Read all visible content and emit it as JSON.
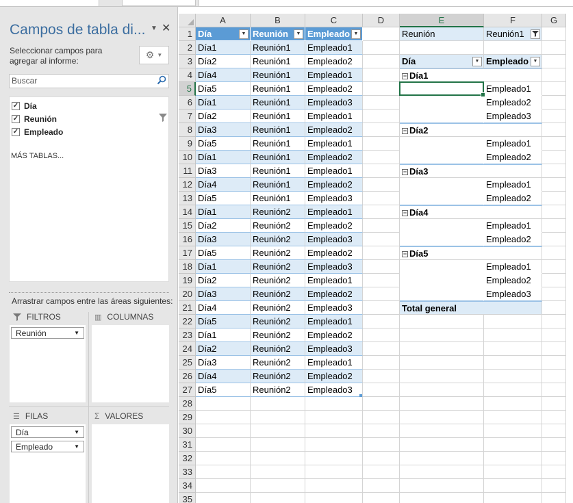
{
  "pane": {
    "title": "Campos de tabla di...",
    "subtitle": "Seleccionar campos para agregar al informe:",
    "search_placeholder": "Buscar",
    "fields": [
      {
        "label": "Día",
        "checked": true
      },
      {
        "label": "Reunión",
        "checked": true,
        "filtered": true
      },
      {
        "label": "Empleado",
        "checked": true
      }
    ],
    "more_tables": "MÁS TABLAS...",
    "drag_label": "Arrastrar campos entre las áreas siguientes:",
    "areas": {
      "filters": {
        "label": "FILTROS",
        "chips": [
          "Reunión"
        ]
      },
      "columns": {
        "label": "COLUMNAS",
        "chips": []
      },
      "rows": {
        "label": "FILAS",
        "chips": [
          "Día",
          "Empleado"
        ]
      },
      "values": {
        "label": "VALORES",
        "chips": []
      }
    }
  },
  "grid": {
    "columns": [
      "A",
      "B",
      "C",
      "D",
      "E",
      "F",
      "G"
    ],
    "selected_column": "E",
    "selected_row": 5,
    "rows": [
      1,
      2,
      3,
      4,
      5,
      6,
      7,
      8,
      9,
      10,
      11,
      12,
      13,
      14,
      15,
      16,
      17,
      18,
      19,
      20,
      21,
      22,
      23,
      24,
      25,
      26,
      27,
      28,
      29,
      30,
      31,
      32,
      33,
      34,
      35
    ],
    "table_headers": [
      "Día",
      "Reunión",
      "Empleado"
    ],
    "table_rows": [
      [
        "Día1",
        "Reunión1",
        "Empleado1"
      ],
      [
        "Día2",
        "Reunión1",
        "Empleado2"
      ],
      [
        "Día4",
        "Reunión1",
        "Empleado1"
      ],
      [
        "Día5",
        "Reunión1",
        "Empleado2"
      ],
      [
        "Día1",
        "Reunión1",
        "Empleado3"
      ],
      [
        "Día2",
        "Reunión1",
        "Empleado1"
      ],
      [
        "Día3",
        "Reunión1",
        "Empleado2"
      ],
      [
        "Día5",
        "Reunión1",
        "Empleado1"
      ],
      [
        "Día1",
        "Reunión1",
        "Empleado2"
      ],
      [
        "Día3",
        "Reunión1",
        "Empleado1"
      ],
      [
        "Día4",
        "Reunión1",
        "Empleado2"
      ],
      [
        "Día5",
        "Reunión1",
        "Empleado3"
      ],
      [
        "Día1",
        "Reunión2",
        "Empleado1"
      ],
      [
        "Día2",
        "Reunión2",
        "Empleado2"
      ],
      [
        "Día3",
        "Reunión2",
        "Empleado3"
      ],
      [
        "Día5",
        "Reunión2",
        "Empleado2"
      ],
      [
        "Día1",
        "Reunión2",
        "Empleado3"
      ],
      [
        "Día2",
        "Reunión2",
        "Empleado1"
      ],
      [
        "Día3",
        "Reunión2",
        "Empleado2"
      ],
      [
        "Día4",
        "Reunión2",
        "Empleado3"
      ],
      [
        "Día5",
        "Reunión2",
        "Empleado1"
      ],
      [
        "Día1",
        "Reunión2",
        "Empleado2"
      ],
      [
        "Día2",
        "Reunión2",
        "Empleado3"
      ],
      [
        "Día3",
        "Reunión2",
        "Empleado1"
      ],
      [
        "Día4",
        "Reunión2",
        "Empleado2"
      ],
      [
        "Día5",
        "Reunión2",
        "Empleado3"
      ]
    ],
    "pivot": {
      "filter_label": "Reunión",
      "filter_value": "Reunión1",
      "row_header": "Día",
      "col_header": "Empleado",
      "groups": [
        {
          "day": "Día1",
          "employees": [
            "Empleado1",
            "Empleado2",
            "Empleado3"
          ]
        },
        {
          "day": "Día2",
          "employees": [
            "Empleado1",
            "Empleado2"
          ]
        },
        {
          "day": "Día3",
          "employees": [
            "Empleado1",
            "Empleado2"
          ]
        },
        {
          "day": "Día4",
          "employees": [
            "Empleado1",
            "Empleado2"
          ]
        },
        {
          "day": "Día5",
          "employees": [
            "Empleado1",
            "Empleado2",
            "Empleado3"
          ]
        }
      ],
      "total_label": "Total general"
    }
  }
}
